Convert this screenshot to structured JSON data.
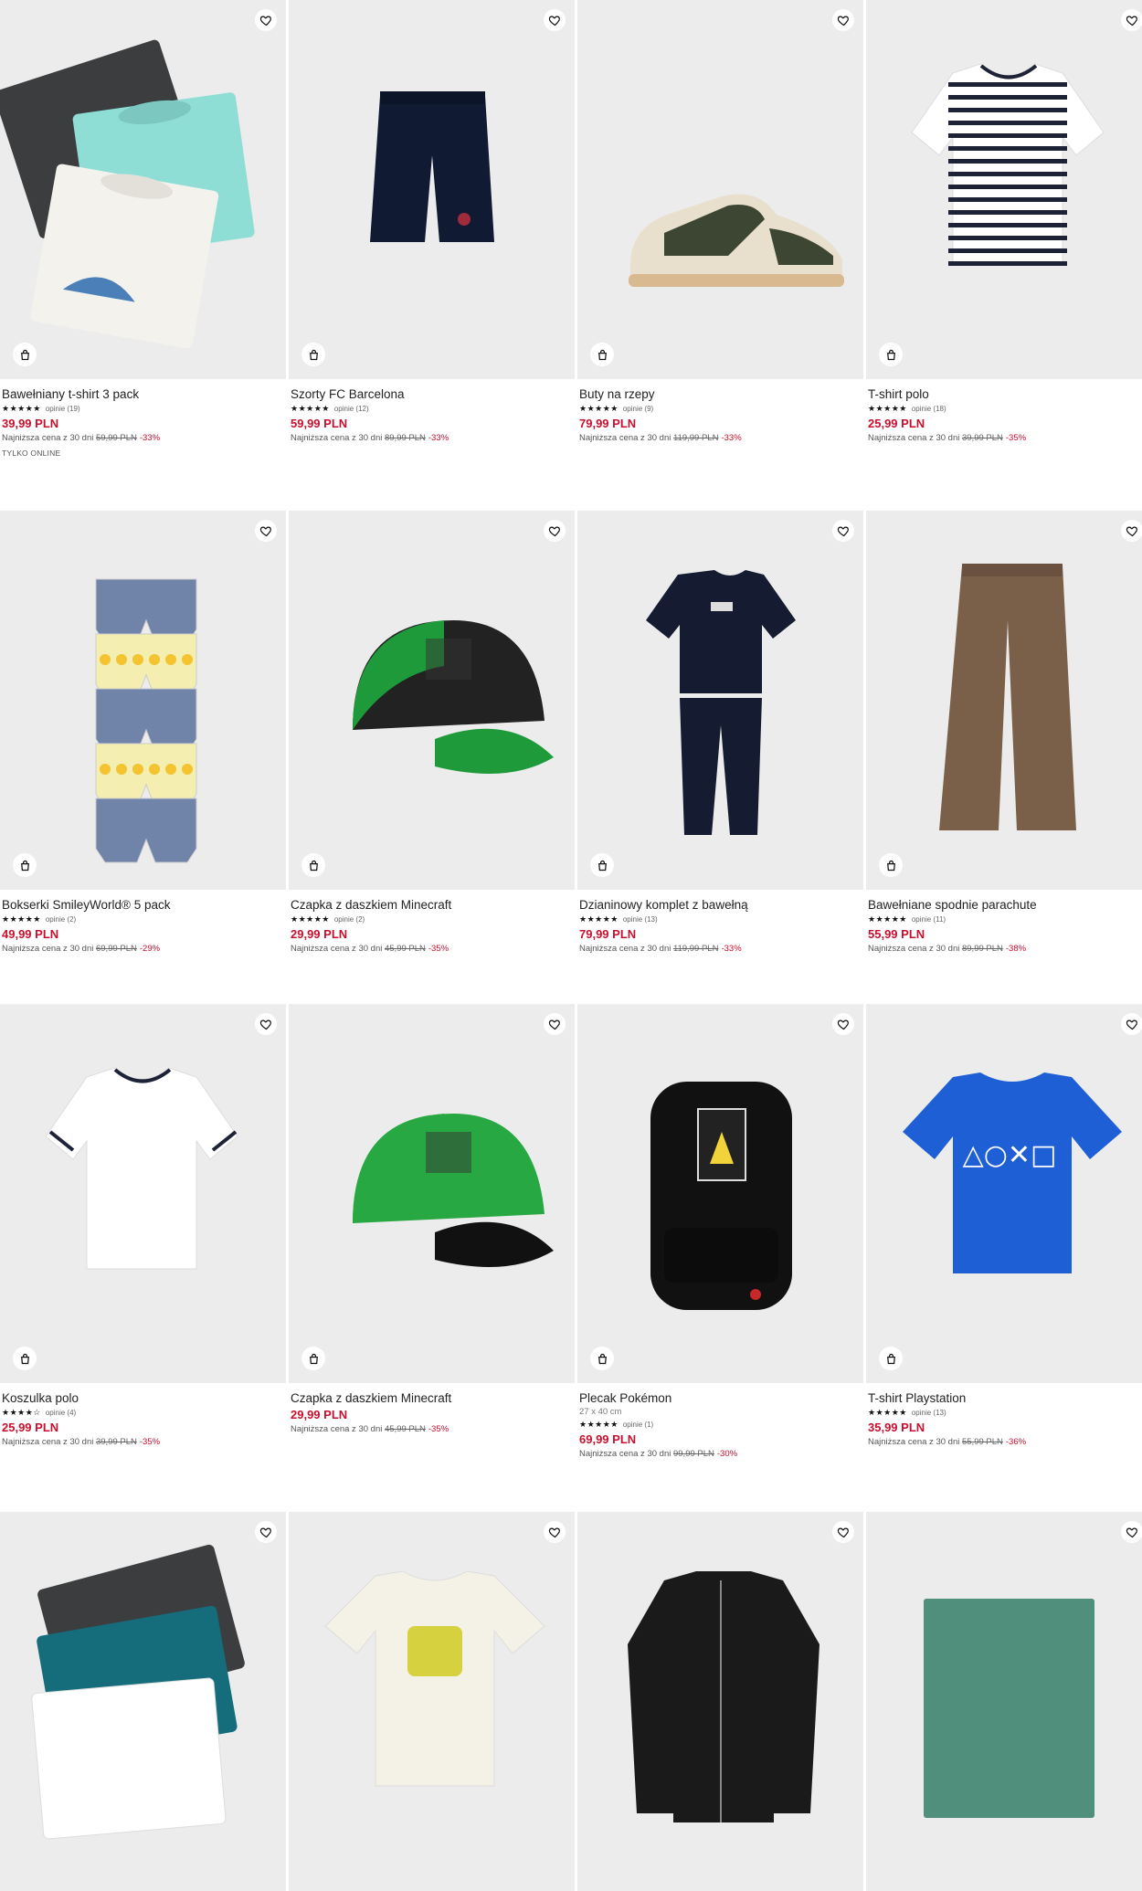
{
  "label_lowest": "Najniższa cena z 30 dni",
  "rows": [
    [
      {
        "name": "Bawełniany t-shirt 3 pack",
        "stars": "★★★★★",
        "reviews": "opinie (19)",
        "price": "39,99 PLN",
        "old": "59,99 PLN",
        "disc": "-33%",
        "tag": "TYLKO ONLINE",
        "art": "tshirt3",
        "colors": [
          "#3b3d3f",
          "#8fded6",
          "#f3f2ec"
        ]
      },
      {
        "name": "Szorty FC Barcelona",
        "stars": "★★★★★",
        "reviews": "opinie (12)",
        "price": "59,99 PLN",
        "old": "89,99 PLN",
        "disc": "-33%",
        "art": "shorts",
        "colors": [
          "#101a33"
        ]
      },
      {
        "name": "Buty na rzepy",
        "stars": "★★★★★",
        "reviews": "opinie (9)",
        "price": "79,99 PLN",
        "old": "119,99 PLN",
        "disc": "-33%",
        "art": "shoe",
        "colors": [
          "#3c4633",
          "#e9dfcd"
        ]
      },
      {
        "name": "T-shirt polo",
        "stars": "★★★★★",
        "reviews": "opinie (18)",
        "price": "25,99 PLN",
        "old": "39,99 PLN",
        "disc": "-35%",
        "art": "polo-stripe",
        "colors": [
          "#ffffff",
          "#1d2236"
        ]
      }
    ],
    [
      {
        "name": "Bokserki SmileyWorld® 5 pack",
        "stars": "★★★★★",
        "reviews": "opinie (2)",
        "price": "49,99 PLN",
        "old": "69,99 PLN",
        "disc": "-29%",
        "art": "boxers",
        "colors": [
          "#7083a8",
          "#f4eeb0"
        ]
      },
      {
        "name": "Czapka z daszkiem Minecraft",
        "stars": "★★★★★",
        "reviews": "opinie (2)",
        "price": "29,99 PLN",
        "old": "45,99 PLN",
        "disc": "-35%",
        "art": "cap",
        "colors": [
          "#1f9a3a",
          "#222222"
        ]
      },
      {
        "name": "Dzianinowy komplet z bawełną",
        "stars": "★★★★★",
        "reviews": "opinie (13)",
        "price": "79,99 PLN",
        "old": "119,99 PLN",
        "disc": "-33%",
        "art": "set",
        "colors": [
          "#151c32"
        ]
      },
      {
        "name": "Bawełniane spodnie parachute",
        "stars": "★★★★★",
        "reviews": "opinie (11)",
        "price": "55,99 PLN",
        "old": "89,99 PLN",
        "disc": "-38%",
        "art": "pants",
        "colors": [
          "#7a5f49"
        ]
      }
    ],
    [
      {
        "name": "Koszulka polo",
        "stars": "★★★★☆",
        "reviews": "opinie (4)",
        "price": "25,99 PLN",
        "old": "39,99 PLN",
        "disc": "-35%",
        "art": "polo-white",
        "colors": [
          "#ffffff",
          "#1d2236"
        ]
      },
      {
        "name": "Czapka z daszkiem Minecraft",
        "price": "29,99 PLN",
        "old": "45,99 PLN",
        "disc": "-35%",
        "art": "cap2",
        "colors": [
          "#28a843",
          "#111111"
        ]
      },
      {
        "name": "Plecak Pokémon",
        "sub": "27 x 40 cm",
        "stars": "★★★★★",
        "reviews": "opinie (1)",
        "price": "69,99 PLN",
        "old": "99,99 PLN",
        "disc": "-30%",
        "art": "backpack",
        "colors": [
          "#111111",
          "#f2d33a"
        ]
      },
      {
        "name": "T-shirt Playstation",
        "stars": "★★★★★",
        "reviews": "opinie (13)",
        "price": "35,99 PLN",
        "old": "55,99 PLN",
        "disc": "-36%",
        "art": "ps-tee",
        "colors": [
          "#1f5fd6"
        ]
      }
    ],
    [
      {
        "art": "tshirt3b",
        "colors": [
          "#3b3d3f",
          "#156d7c",
          "#ffffff"
        ]
      },
      {
        "art": "tee-print",
        "colors": [
          "#f4f1e6",
          "#d6d23f"
        ]
      },
      {
        "art": "jacket",
        "colors": [
          "#1a1a1a"
        ]
      },
      {
        "art": "scarf",
        "colors": [
          "#4f8f7c"
        ]
      }
    ]
  ]
}
